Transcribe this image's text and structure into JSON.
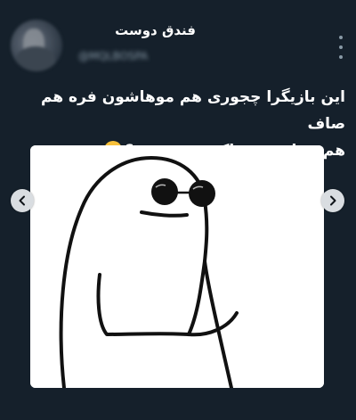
{
  "tweet": {
    "author": {
      "display_name": "فندق دوست",
      "handle": "@MQLBOSPA"
    },
    "text_line1": "این بازیگرا چجوری هم موهاشون فره هم صاف",
    "text_line2": "هم زیبان هم خاک تو سر منه؟",
    "emoji": "unamused-face"
  },
  "icons": {
    "more": "vertical-ellipsis-icon",
    "prev": "chevron-left-icon",
    "next": "chevron-right-icon"
  },
  "colors": {
    "background": "#15202b",
    "text": "#ffffff",
    "secondary_text": "#8899a6",
    "nav_button": "#d9dde1"
  }
}
